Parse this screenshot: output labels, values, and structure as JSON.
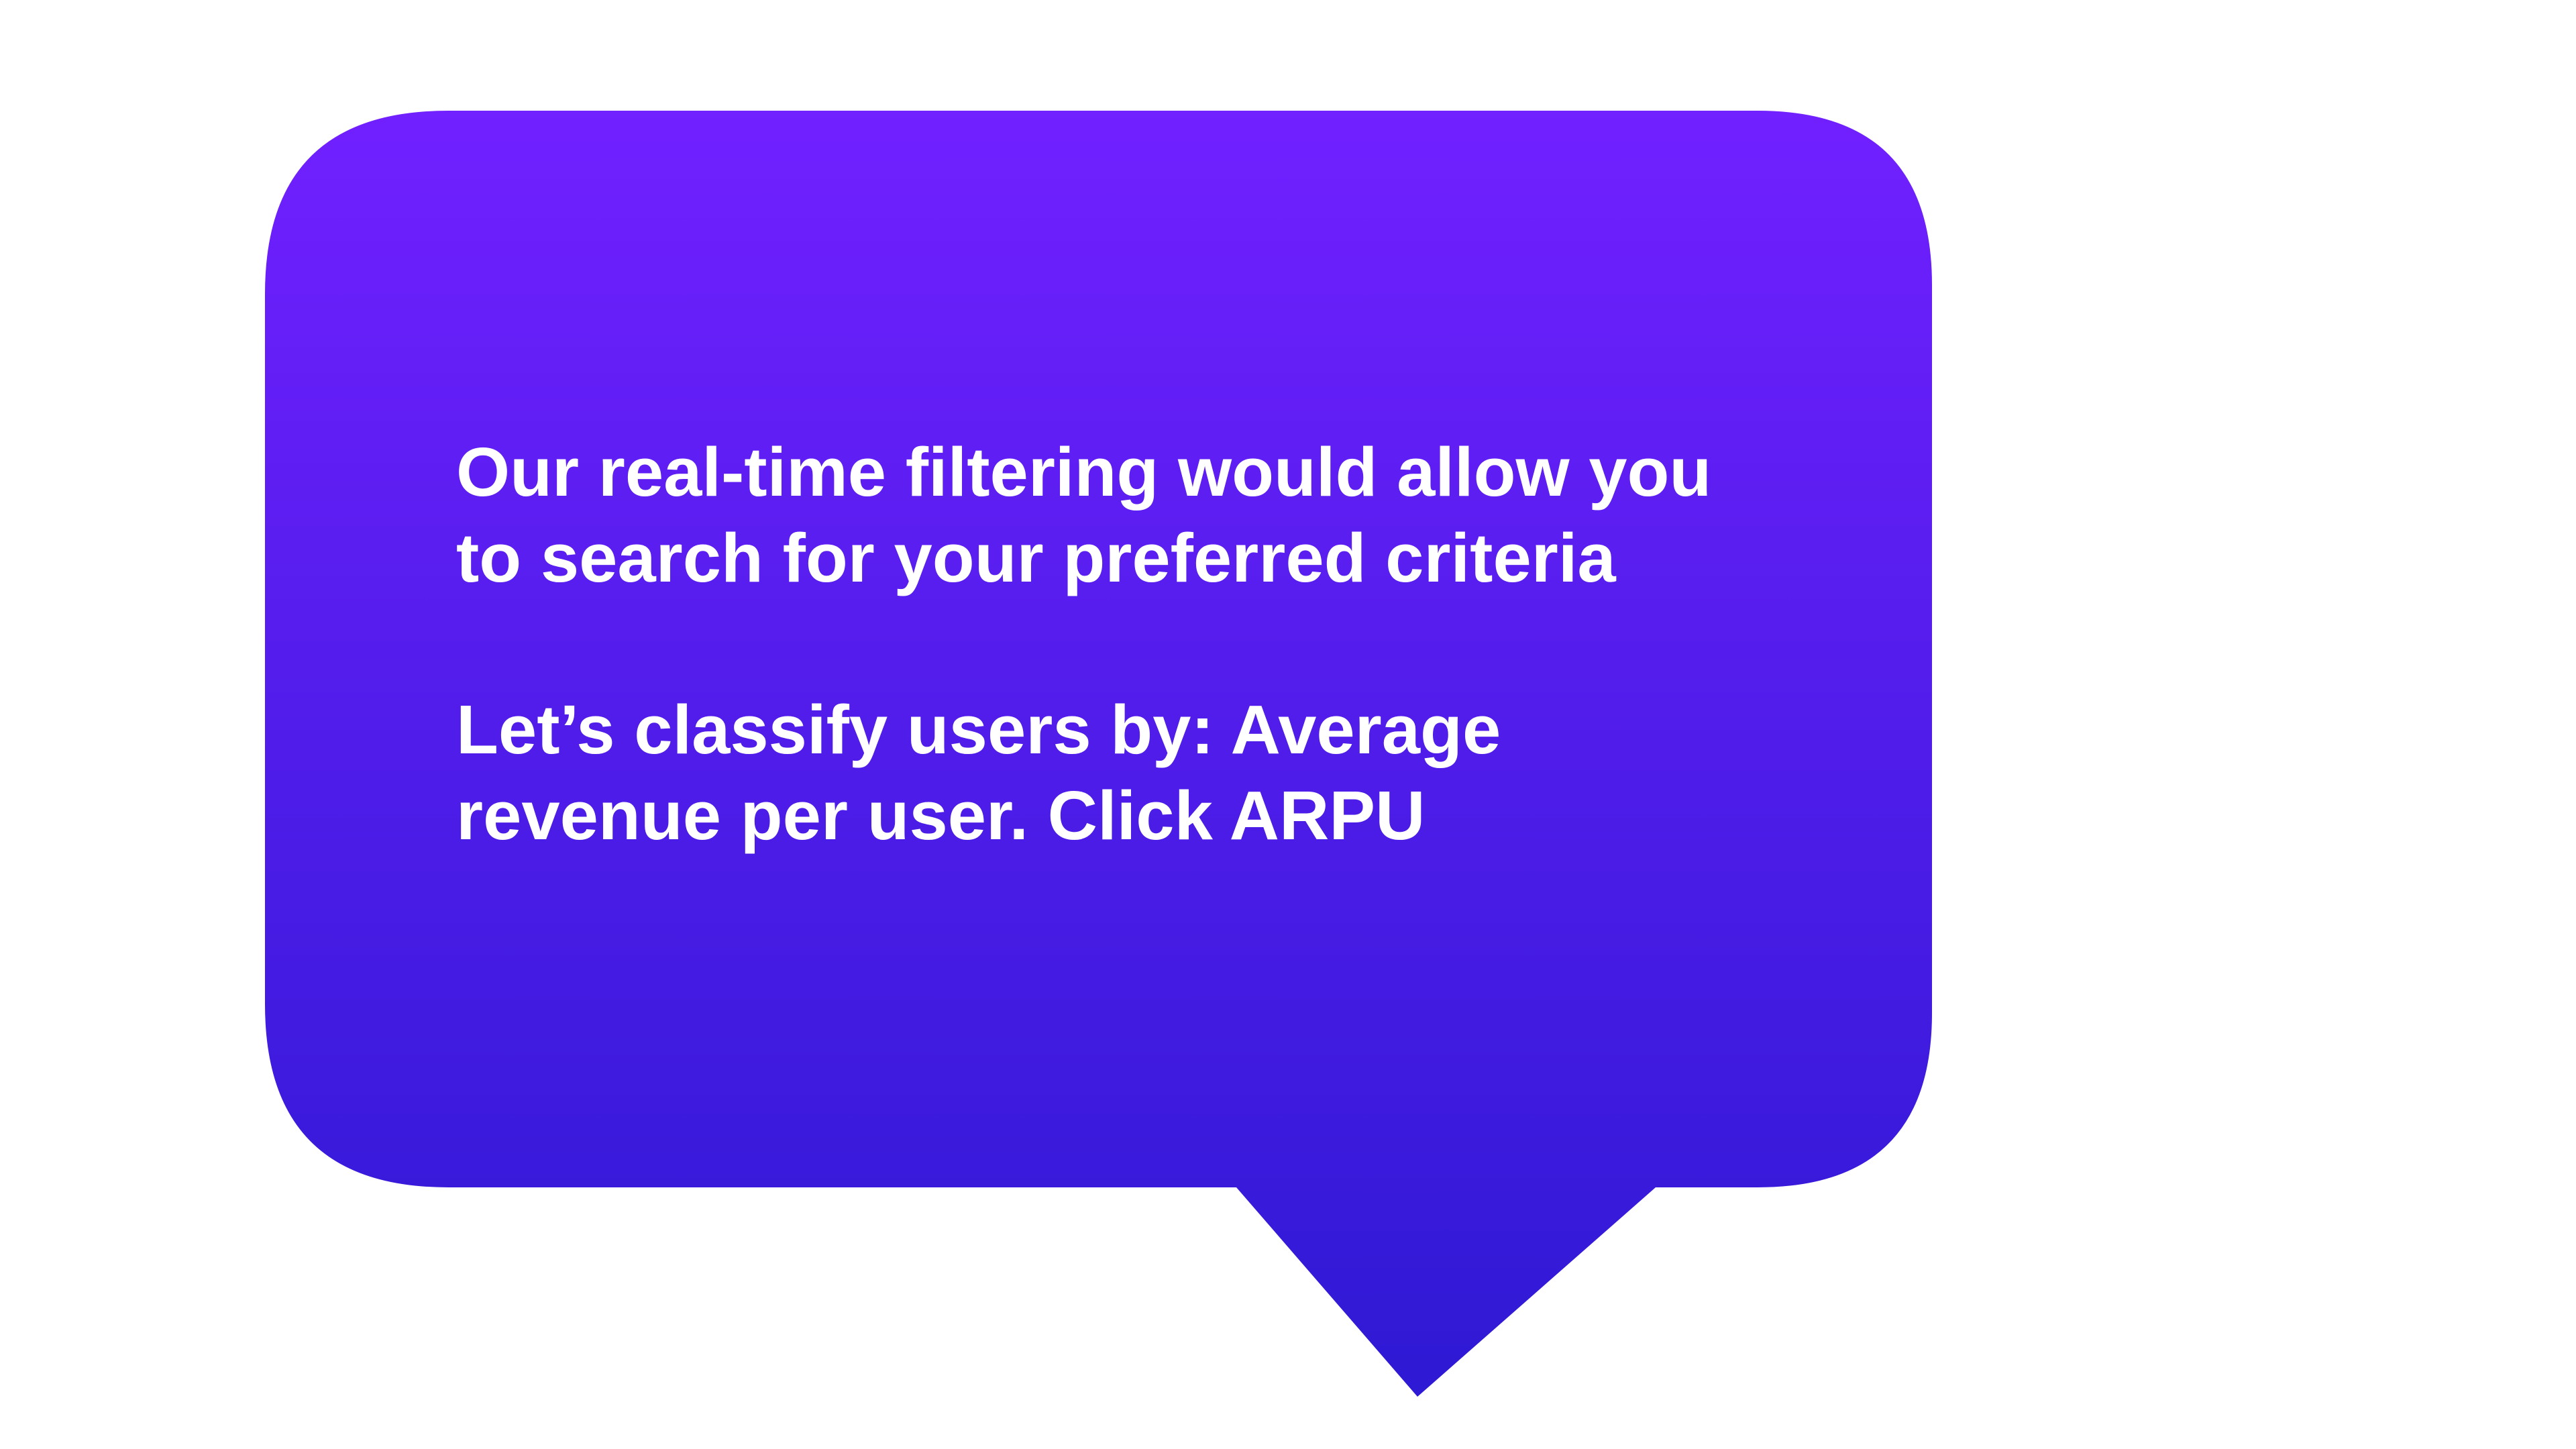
{
  "tooltip": {
    "paragraph_1": {
      "line_1": "Our real-time filtering would allow you",
      "line_2": "to search for your preferred criteria"
    },
    "paragraph_2": {
      "line_1": "Let’s classify users by: Average",
      "line_2": "revenue per user. Click ARPU"
    }
  },
  "colors": {
    "bubble_top": "#7120FF",
    "bubble_bottom": "#2E19D4",
    "text": "#FFFFFF",
    "background": "#FFFFFF"
  }
}
